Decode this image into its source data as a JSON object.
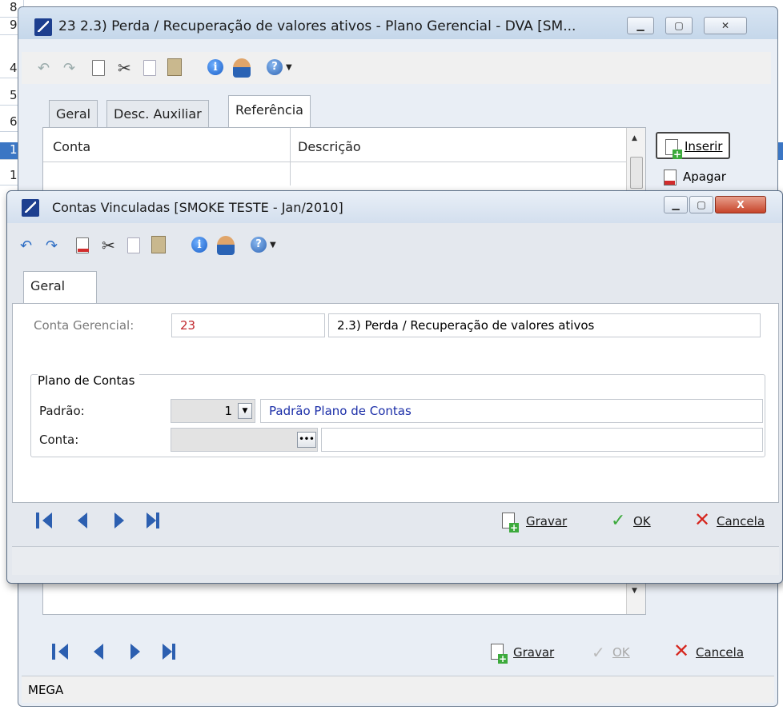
{
  "spreadsheet": {
    "rows": [
      "8",
      "9",
      "4",
      "5",
      "6",
      "1",
      "1"
    ]
  },
  "back_window": {
    "title": "23 2.3) Perda / Recuperação de valores ativos -  Plano Gerencial - DVA [SM...",
    "tabs": [
      "Geral",
      "Desc. Auxiliar",
      "Referência"
    ],
    "grid_headers": [
      "Conta",
      "Descrição"
    ],
    "side_buttons": [
      "Inserir",
      "Apagar"
    ],
    "actions": {
      "save": "Gravar",
      "ok": "OK",
      "cancel": "Cancela"
    },
    "status": "MEGA"
  },
  "front_window": {
    "title": "Contas Vinculadas [SMOKE TESTE - Jan/2010]",
    "tab": "Geral",
    "conta_gerencial_label": "Conta Gerencial:",
    "conta_gerencial_code": "23",
    "conta_gerencial_desc": "2.3) Perda / Recuperação de valores ativos",
    "group_title": "Plano de Contas",
    "padrao_label": "Padrão:",
    "padrao_value": "1",
    "padrao_desc": "Padrão Plano de Contas",
    "conta_label": "Conta:",
    "conta_value": "",
    "conta_button": "•••",
    "actions": {
      "save": "Gravar",
      "ok": "OK",
      "cancel": "Cancela"
    }
  },
  "colors": {
    "accent_blue": "#2c5fb0",
    "danger_red": "#d6261e",
    "ok_green": "#3caa3c",
    "code_red": "#c1272d",
    "link_blue": "#1b2ea8"
  }
}
